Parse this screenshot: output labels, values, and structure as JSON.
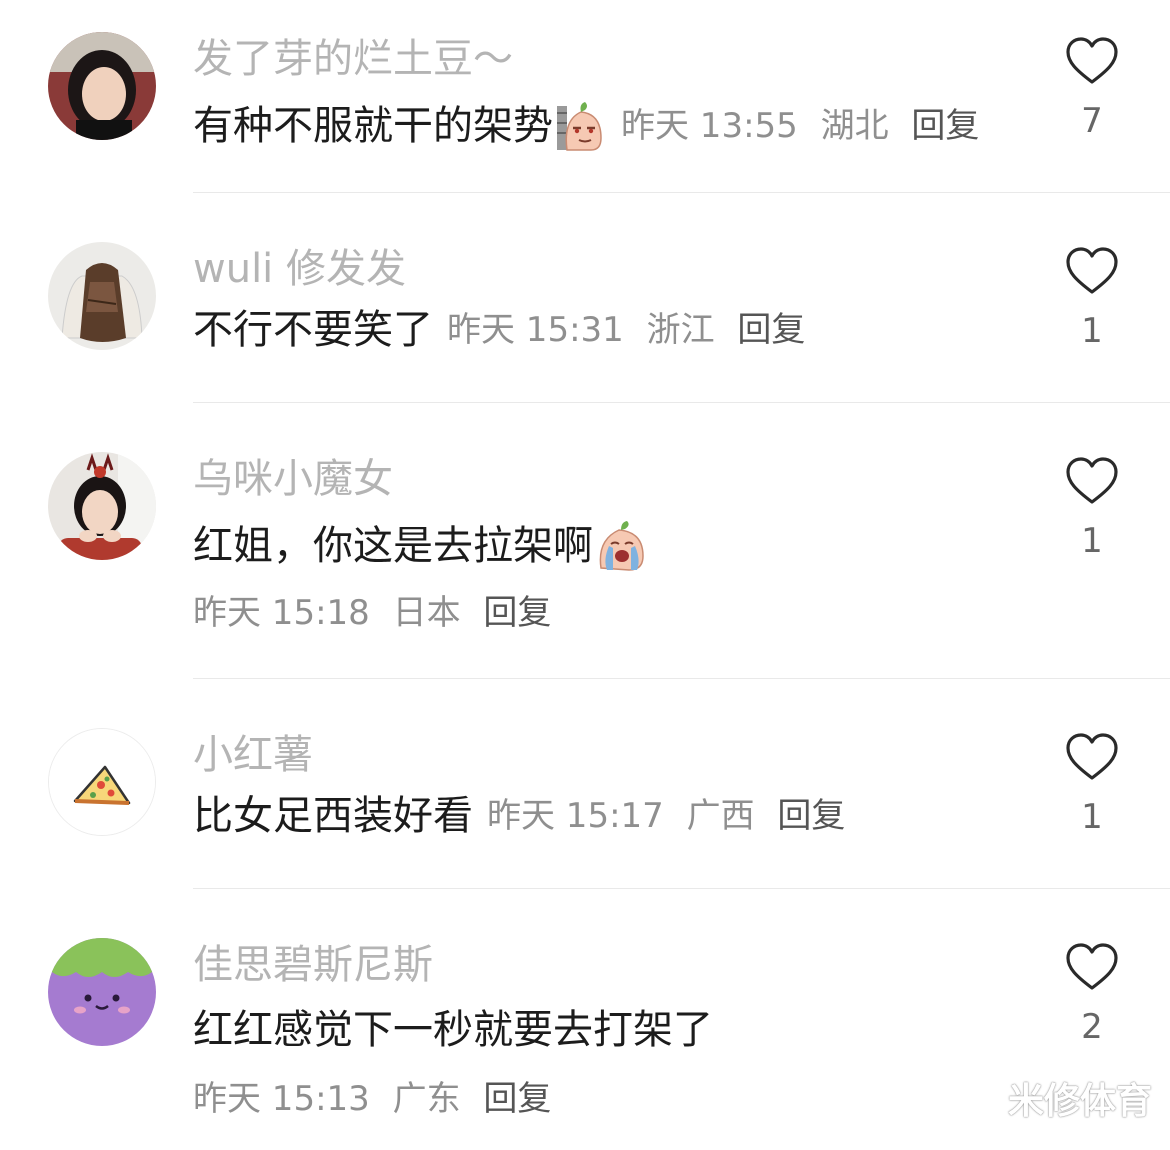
{
  "comments": [
    {
      "username": "发了芽的烂土豆～",
      "text": "有种不服就干的架势",
      "emoji": "sly-potato-emoji",
      "time": "昨天 13:55",
      "location": "湖北",
      "reply": "回复",
      "likes": "7"
    },
    {
      "username": "wuli 修发发",
      "text": "不行不要笑了",
      "time": "昨天 15:31",
      "location": "浙江",
      "reply": "回复",
      "likes": "1"
    },
    {
      "username": "乌咪小魔女",
      "text": "红姐，你这是去拉架啊",
      "emoji": "crying-potato-emoji",
      "time": "昨天 15:18",
      "location": "日本",
      "reply": "回复",
      "likes": "1"
    },
    {
      "username": "小红薯",
      "text": "比女足西装好看",
      "time": "昨天 15:17",
      "location": "广西",
      "reply": "回复",
      "likes": "1"
    },
    {
      "username": "佳思碧斯尼斯",
      "text": "红红感觉下一秒就要去打架了",
      "time": "昨天 15:13",
      "location": "广东",
      "reply": "回复",
      "likes": "2"
    }
  ],
  "watermark": "米修体育",
  "icons": {
    "like": "heart-outline-icon"
  },
  "colors": {
    "username": "#b4b4b4",
    "text": "#1c1c1c",
    "meta": "#8f8f8f",
    "divider": "#e9e9e9"
  }
}
